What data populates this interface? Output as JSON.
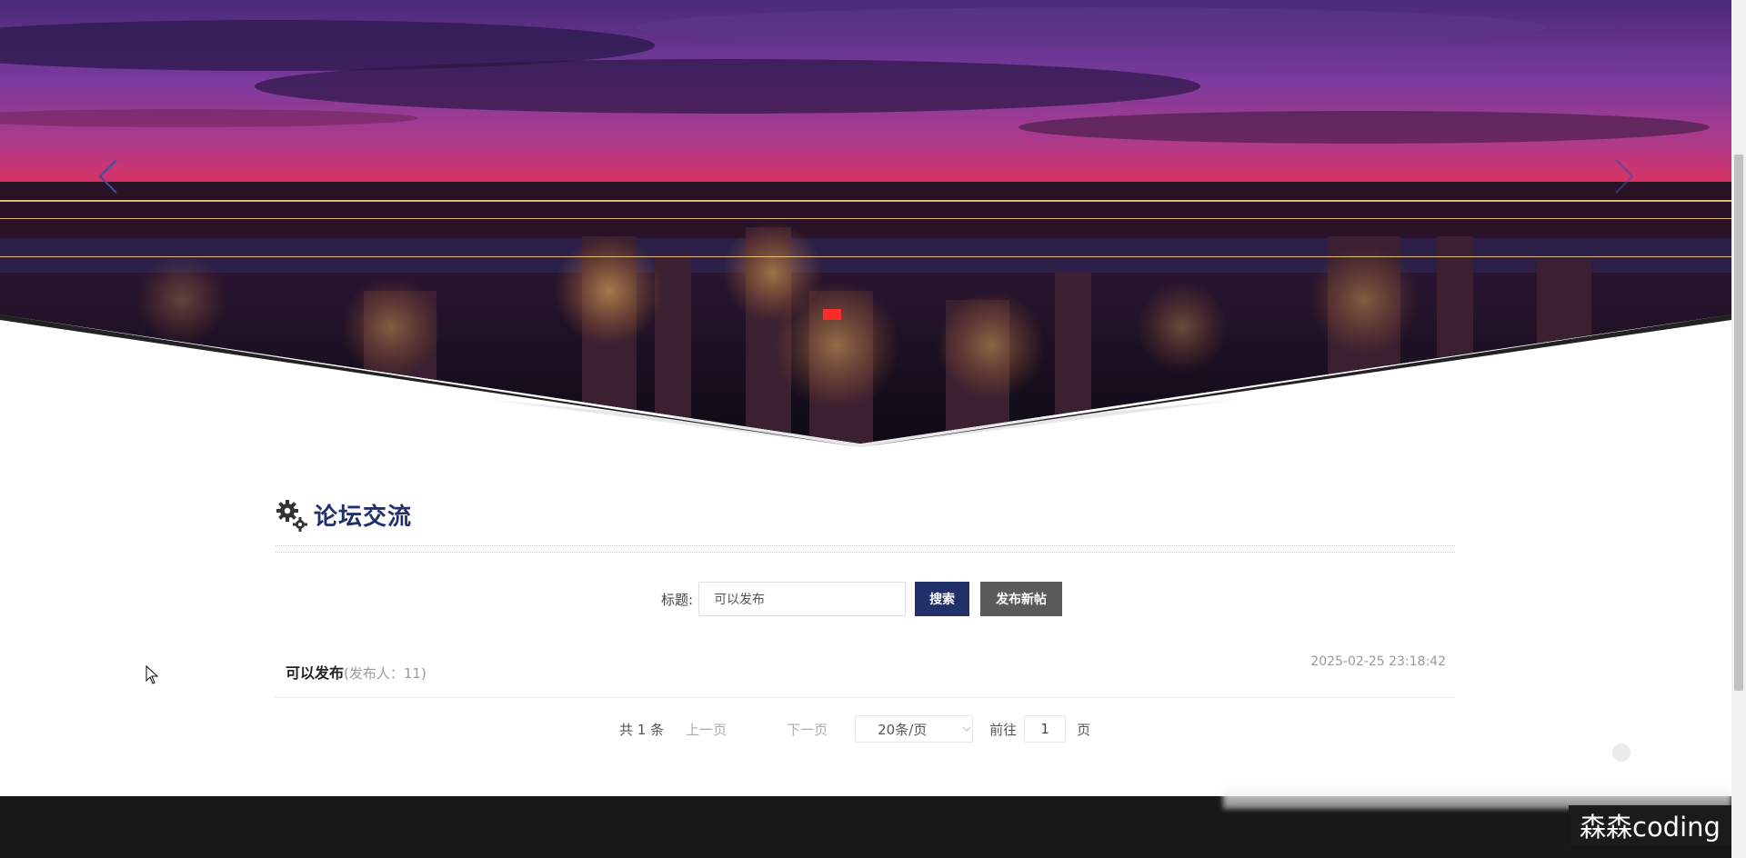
{
  "banner": {
    "prev_label": "previous-slide",
    "next_label": "next-slide"
  },
  "section": {
    "title": "论坛交流",
    "icon": "gears-icon"
  },
  "search": {
    "label": "标题:",
    "value": "可以发布",
    "search_button": "搜索",
    "post_button": "发布新帖"
  },
  "posts": [
    {
      "title": "可以发布",
      "author": "(发布人：11)",
      "date": "2025-02-25 23:18:42"
    }
  ],
  "pagination": {
    "total": "共 1 条",
    "prev": "上一页",
    "next": "下一页",
    "page_size": "20条/页",
    "goto_label": "前往",
    "current_page": "1",
    "page_suffix": "页"
  },
  "watermark": "森森coding",
  "colors": {
    "brand": "#22306a",
    "post_button": "#5a5a5a",
    "footer": "#181818"
  }
}
